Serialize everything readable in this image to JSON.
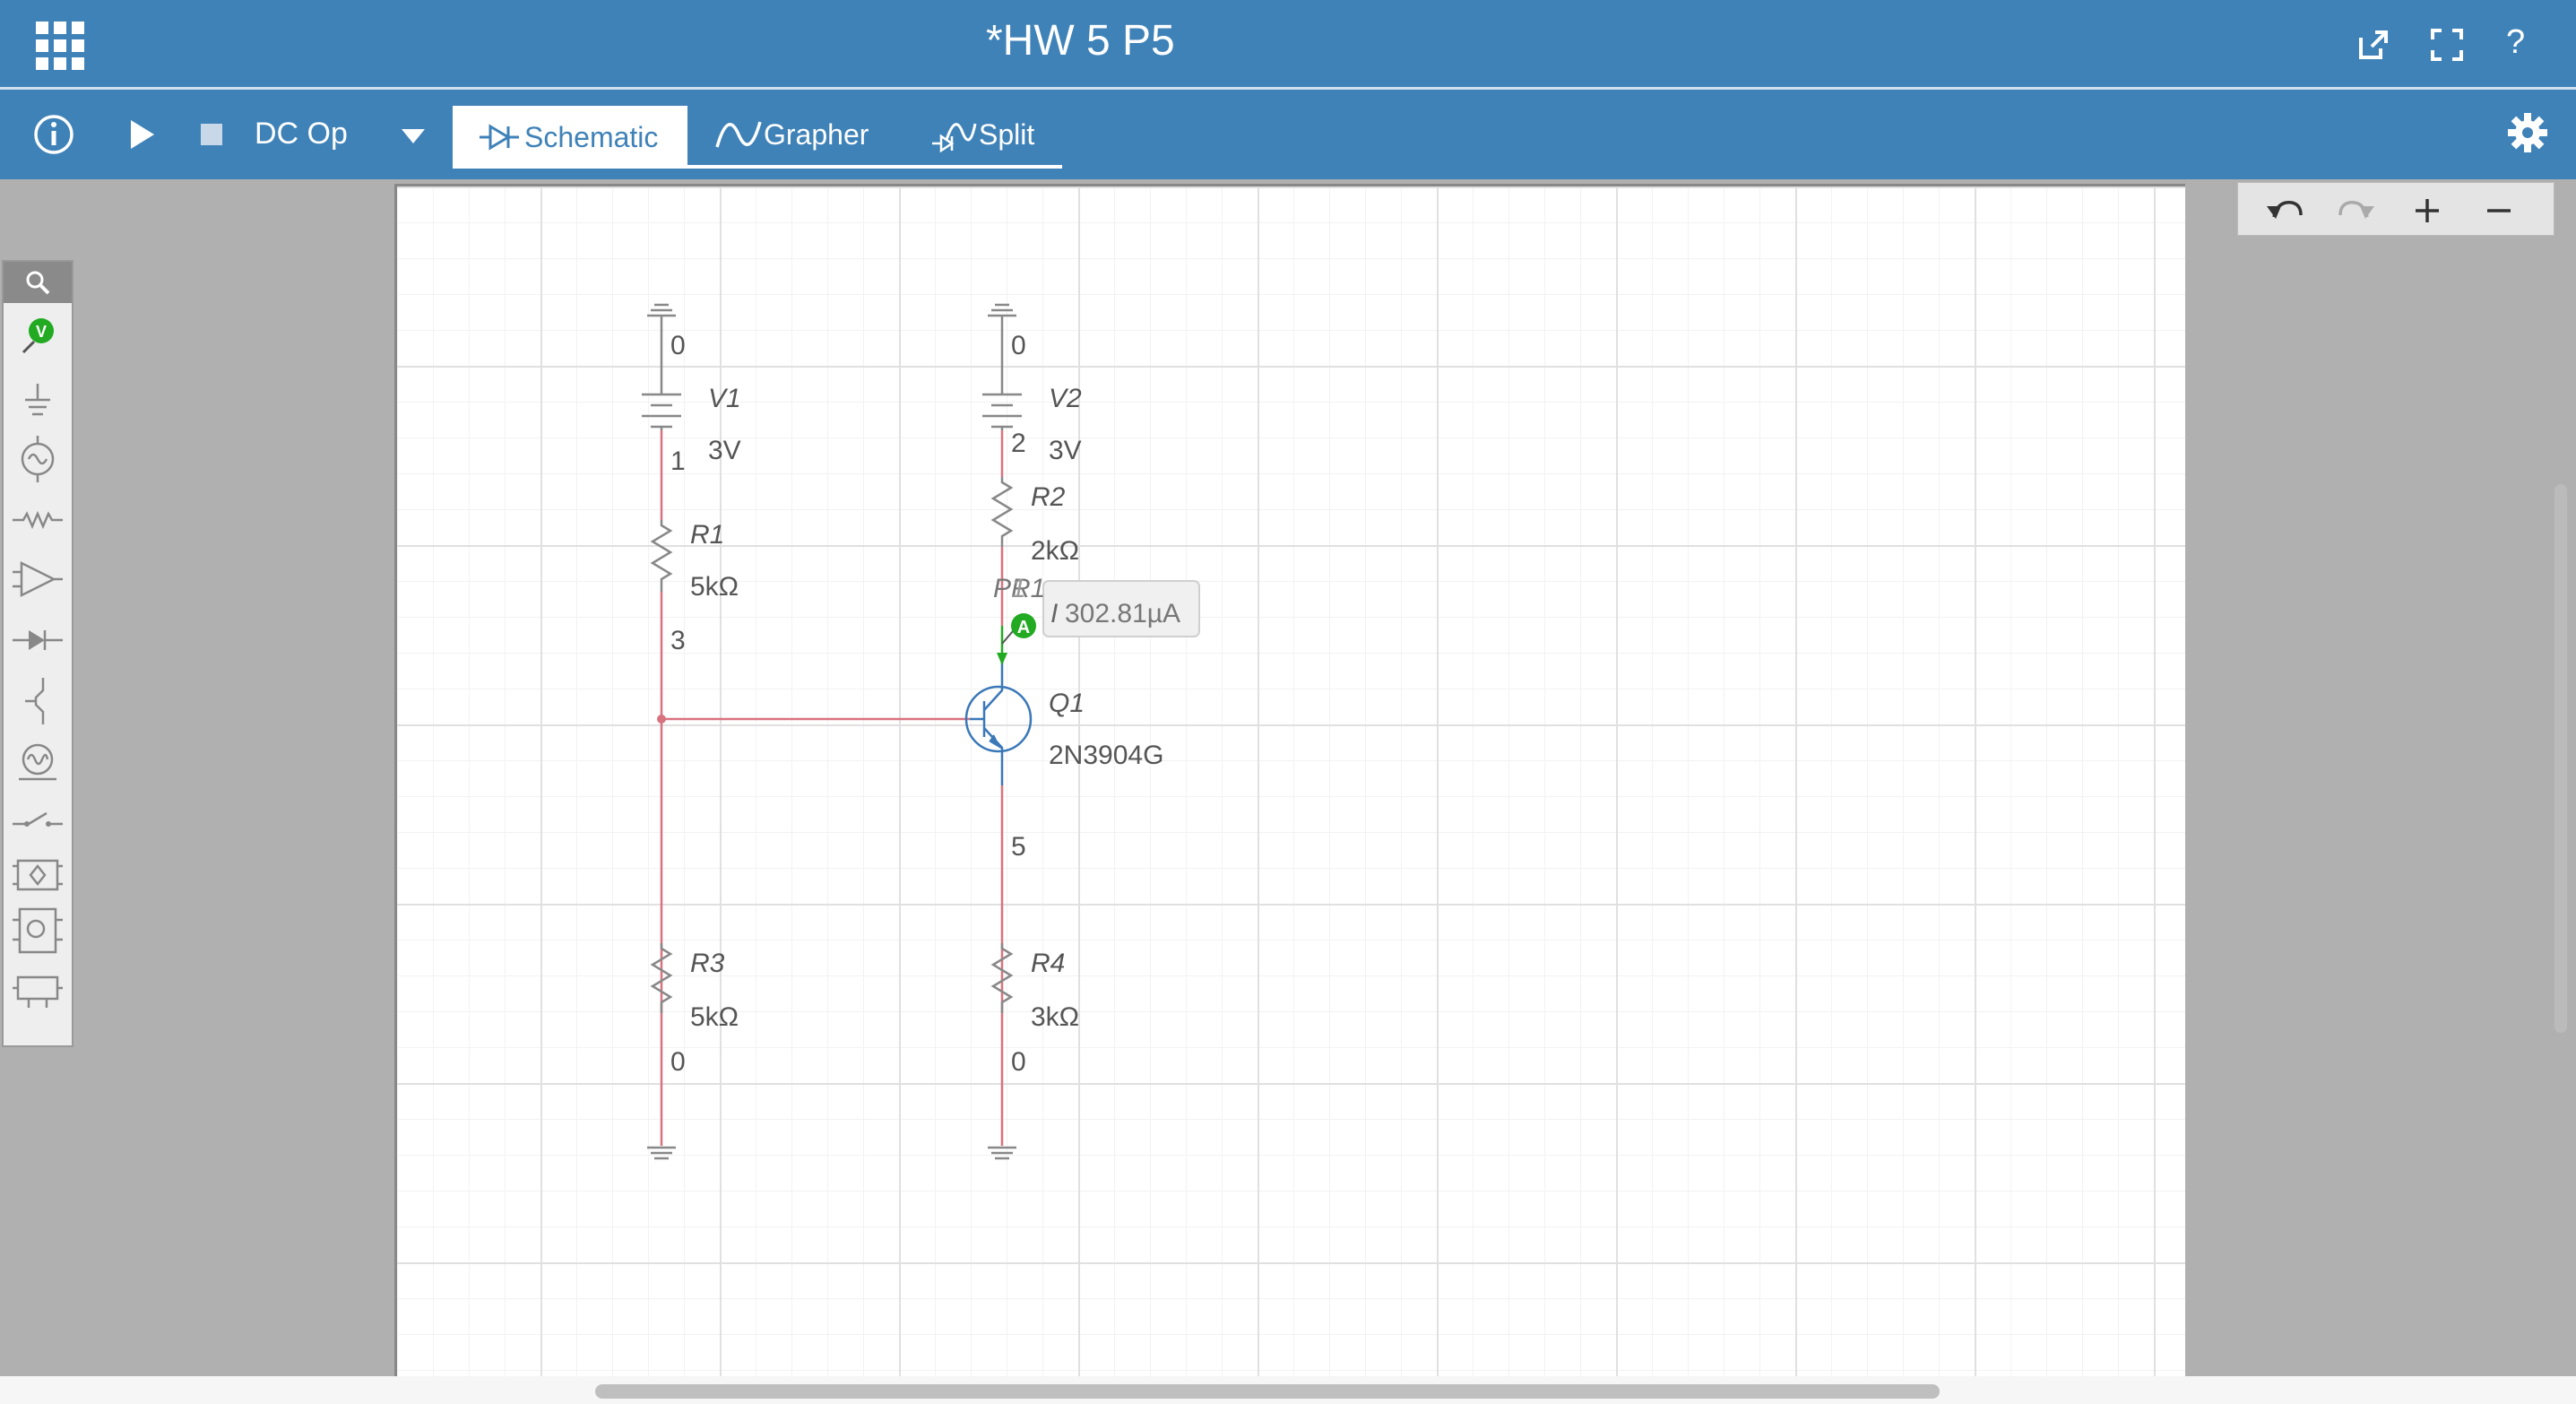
{
  "header": {
    "title": "*HW 5 P5",
    "apps_icon": "apps-grid-icon",
    "share_icon": "share-icon",
    "fullscreen_icon": "fullscreen-icon",
    "help_label": "?"
  },
  "toolbar": {
    "analysis": "DC Op",
    "tabs": [
      "Schematic",
      "Grapher",
      "Split"
    ],
    "active_tab": "Schematic"
  },
  "colors": {
    "accent": "#3f82b8",
    "wire": "#d9727f",
    "transistor": "#3a78b8",
    "probe": "#22aa22"
  },
  "schematic": {
    "nodes": {
      "v1_top": "0",
      "v2_top": "0",
      "n1": "1",
      "n2": "2",
      "n3": "3",
      "n5": "5",
      "r3_bottom": "0",
      "r4_bottom": "0"
    },
    "v1": {
      "name": "V1",
      "value": "3V"
    },
    "v2": {
      "name": "V2",
      "value": "3V"
    },
    "r1": {
      "name": "R1",
      "value": "5kΩ"
    },
    "r2": {
      "name": "R2",
      "value": "2kΩ"
    },
    "r3": {
      "name": "R3",
      "value": "5kΩ"
    },
    "r4": {
      "name": "R4",
      "value": "3kΩ"
    },
    "q1": {
      "name": "Q1",
      "model": "2N3904G"
    },
    "probe": {
      "name": "PR1",
      "overlap": "1",
      "icon_label": "A",
      "reading_prefix": "I",
      "reading": "302.81µA"
    }
  }
}
